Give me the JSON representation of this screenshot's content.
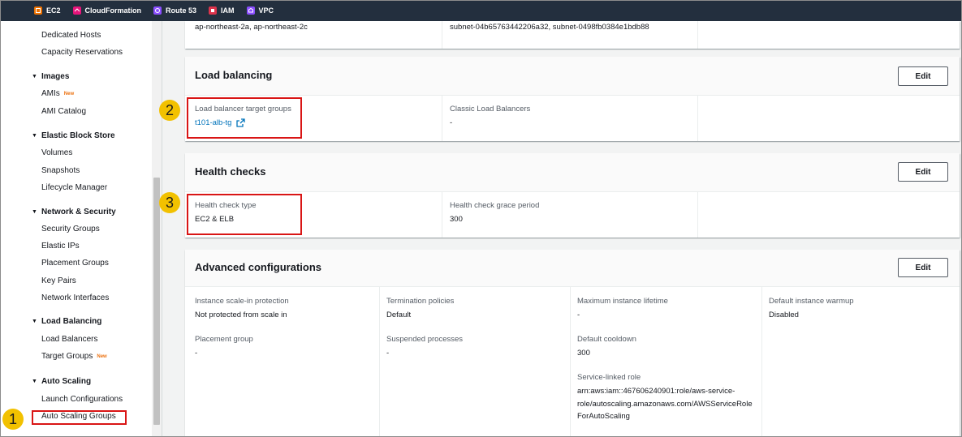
{
  "topbar": {
    "favorites": [
      {
        "label": "EC2",
        "icon": "ec2-icon",
        "color": "#ed7100"
      },
      {
        "label": "CloudFormation",
        "icon": "cloudformation-icon",
        "color": "#e7157b"
      },
      {
        "label": "Route 53",
        "icon": "route53-icon",
        "color": "#8c4fff"
      },
      {
        "label": "IAM",
        "icon": "iam-icon",
        "color": "#dd344c"
      },
      {
        "label": "VPC",
        "icon": "vpc-icon",
        "color": "#8c4fff"
      }
    ]
  },
  "sidebar": {
    "items": {
      "dedicated_hosts": "Dedicated Hosts",
      "capacity_reservations": "Capacity Reservations",
      "images_header": "Images",
      "amis": "AMIs",
      "amis_badge": "New",
      "ami_catalog": "AMI Catalog",
      "ebs_header": "Elastic Block Store",
      "volumes": "Volumes",
      "snapshots": "Snapshots",
      "lifecycle_manager": "Lifecycle Manager",
      "network_header": "Network & Security",
      "security_groups": "Security Groups",
      "elastic_ips": "Elastic IPs",
      "placement_groups": "Placement Groups",
      "key_pairs": "Key Pairs",
      "network_interfaces": "Network Interfaces",
      "lb_header": "Load Balancing",
      "load_balancers": "Load Balancers",
      "target_groups": "Target Groups",
      "target_groups_badge": "New",
      "as_header": "Auto Scaling",
      "launch_configurations": "Launch Configurations",
      "auto_scaling_groups": "Auto Scaling Groups"
    }
  },
  "network_panel": {
    "azs": "ap-northeast-2a, ap-northeast-2c",
    "subnets": "subnet-04b65763442206a32, subnet-0498fb0384e1bdb88"
  },
  "load_balancing": {
    "title": "Load balancing",
    "edit": "Edit",
    "tg_label": "Load balancer target groups",
    "tg_value": "t101-alb-tg",
    "clb_label": "Classic Load Balancers",
    "clb_value": "-"
  },
  "health_checks": {
    "title": "Health checks",
    "edit": "Edit",
    "type_label": "Health check type",
    "type_value": "EC2 & ELB",
    "grace_label": "Health check grace period",
    "grace_value": "300"
  },
  "advanced": {
    "title": "Advanced configurations",
    "edit": "Edit",
    "scale_in_label": "Instance scale-in protection",
    "scale_in_value": "Not protected from scale in",
    "termination_label": "Termination policies",
    "termination_value": "Default",
    "max_lifetime_label": "Maximum instance lifetime",
    "max_lifetime_value": "-",
    "warmup_label": "Default instance warmup",
    "warmup_value": "Disabled",
    "placement_label": "Placement group",
    "placement_value": "-",
    "suspended_label": "Suspended processes",
    "suspended_value": "-",
    "cooldown_label": "Default cooldown",
    "cooldown_value": "300",
    "slr_label": "Service-linked role",
    "slr_line1": "arn:aws:iam::467606240901:role/aws-service-",
    "slr_line2": "role/autoscaling.amazonaws.com/AWSServiceRole",
    "slr_line3": "ForAutoScaling"
  },
  "annotations": {
    "step1": "1",
    "step2": "2",
    "step3": "3",
    "highlight_color": "#d91515",
    "badge_color": "#f2c100"
  }
}
